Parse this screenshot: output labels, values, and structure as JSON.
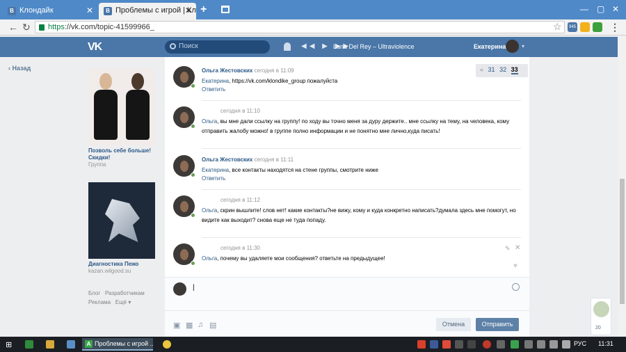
{
  "browser": {
    "tabs": [
      {
        "label": "Клондайк"
      },
      {
        "label": "Проблемы с игрой | Клондайк"
      }
    ],
    "url_scheme": "https:",
    "url_rest": "//vk.com/topic-41599966_",
    "ext_badge": "945"
  },
  "vk": {
    "search_placeholder": "Поиск",
    "track": "Lana Del Rey – Ultraviolence",
    "user_name": "Екатерина",
    "back_label": "Назад"
  },
  "ads": [
    {
      "title": "Позволь себе больше! Скидки!",
      "sub": "Группа"
    },
    {
      "title": "Диагностика Пежо",
      "sub": "kazan.wilgood.su"
    }
  ],
  "footer": {
    "links": [
      "Блог",
      "Разработчикам",
      "Реклама",
      "Ещё"
    ]
  },
  "pager": {
    "prev": "«",
    "pages": [
      "31",
      "32",
      "33"
    ]
  },
  "posts": [
    {
      "author": "Ольга Жестовских",
      "date": "сегодня в 11:09",
      "addr": "Екатерина",
      "text": ", https://vk.com/klondike_group пожалуйста",
      "reply": "Ответить"
    },
    {
      "author": "",
      "date": "сегодня в 11:10",
      "addr": "Ольга",
      "text": ", вы мне дали ссылку на группу! по ходу вы точно меня за дуру держите.. мне ссылку на тему, на человека, кому отправить жалобу можно! в группе полно информации и не понятно мне лично,куда писать!",
      "reply": ""
    },
    {
      "author": "Ольга Жестовских",
      "date": "сегодня в 11:11",
      "addr": "Екатерина",
      "text": ", все контакты находятся на стене группы, смотрите ниже",
      "reply": "Ответить"
    },
    {
      "author": "",
      "date": "сегодня в 11:12",
      "addr": "Ольга",
      "text": ", скрин вышлите! слов нет! какие контакты?не вижу, кому и куда конкретно написать?думала здесь мне помогут, но видите как выходит? снова еще не туда попаду.",
      "reply": ""
    },
    {
      "author": "",
      "date": "сегодня в 11:30",
      "addr": "Ольга",
      "text": ", почему вы удаляете мои сообщения? ответьте на предыдущее!",
      "reply": ""
    }
  ],
  "composer": {
    "value": "|",
    "cancel_label": "Отмена",
    "send_label": "Отправить"
  },
  "chat_widget": {
    "count": "20"
  },
  "taskbar": {
    "app_label": "Проблемы с игрой ...",
    "lang": "РУС",
    "time": "11:31"
  }
}
